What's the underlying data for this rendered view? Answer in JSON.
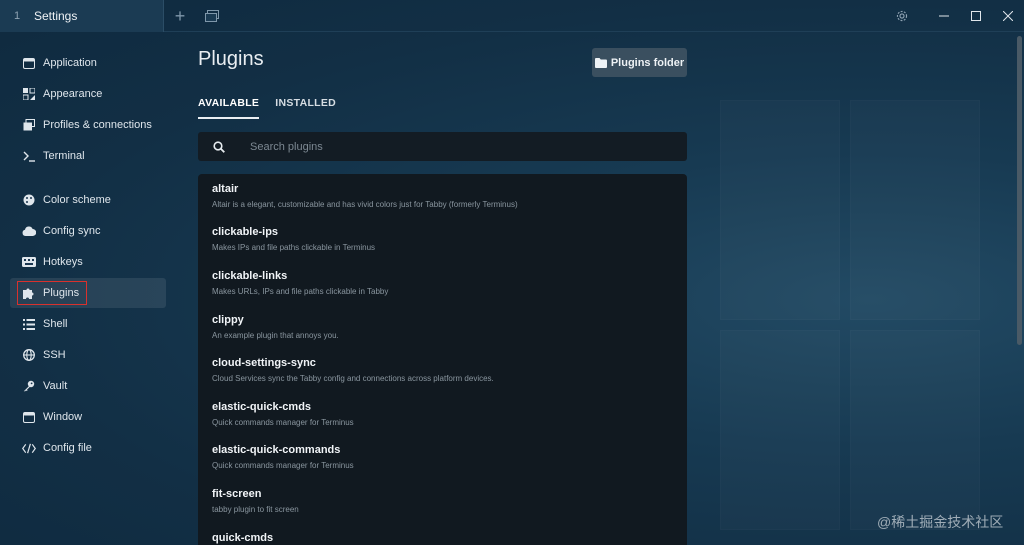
{
  "titlebar": {
    "tab_number": "1",
    "tab_title": "Settings",
    "new_tab_symbol": "+"
  },
  "sidebar": {
    "items": [
      {
        "label": "Application",
        "icon": "window-icon"
      },
      {
        "label": "Appearance",
        "icon": "palette-icon"
      },
      {
        "label": "Profiles & connections",
        "icon": "windows-stack-icon"
      },
      {
        "label": "Terminal",
        "icon": "terminal-icon"
      },
      {
        "label": "Color scheme",
        "icon": "palette-icon"
      },
      {
        "label": "Config sync",
        "icon": "cloud-icon"
      },
      {
        "label": "Hotkeys",
        "icon": "keyboard-icon"
      },
      {
        "label": "Plugins",
        "icon": "puzzle-icon",
        "active": true
      },
      {
        "label": "Shell",
        "icon": "list-icon"
      },
      {
        "label": "SSH",
        "icon": "globe-icon"
      },
      {
        "label": "Vault",
        "icon": "key-icon"
      },
      {
        "label": "Window",
        "icon": "window-icon"
      },
      {
        "label": "Config file",
        "icon": "code-icon"
      }
    ]
  },
  "main": {
    "title": "Plugins",
    "folder_button": "Plugins folder",
    "tabs": [
      {
        "label": "AVAILABLE",
        "active": true
      },
      {
        "label": "INSTALLED",
        "active": false
      }
    ],
    "search_placeholder": "Search plugins",
    "plugins": [
      {
        "name": "altair",
        "description": "Altair is a elegant, customizable and has vivid colors just for Tabby (formerly Terminus)"
      },
      {
        "name": "clickable-ips",
        "description": "Makes IPs and file paths clickable in Terminus"
      },
      {
        "name": "clickable-links",
        "description": "Makes URLs, IPs and file paths clickable in Tabby"
      },
      {
        "name": "clippy",
        "description": "An example plugin that annoys you."
      },
      {
        "name": "cloud-settings-sync",
        "description": "Cloud Services sync the Tabby config and connections across platform devices."
      },
      {
        "name": "elastic-quick-cmds",
        "description": "Quick commands manager for Terminus"
      },
      {
        "name": "elastic-quick-commands",
        "description": "Quick commands manager for Terminus"
      },
      {
        "name": "fit-screen",
        "description": "tabby plugin to fit screen"
      },
      {
        "name": "quick-cmds",
        "description": ""
      }
    ]
  },
  "watermark": "@稀土掘金技术社区",
  "colors": {
    "highlight_box": "#d9312d",
    "plugin_list_bg": "#111920",
    "sidebar_active_bg": "#2a4054"
  }
}
